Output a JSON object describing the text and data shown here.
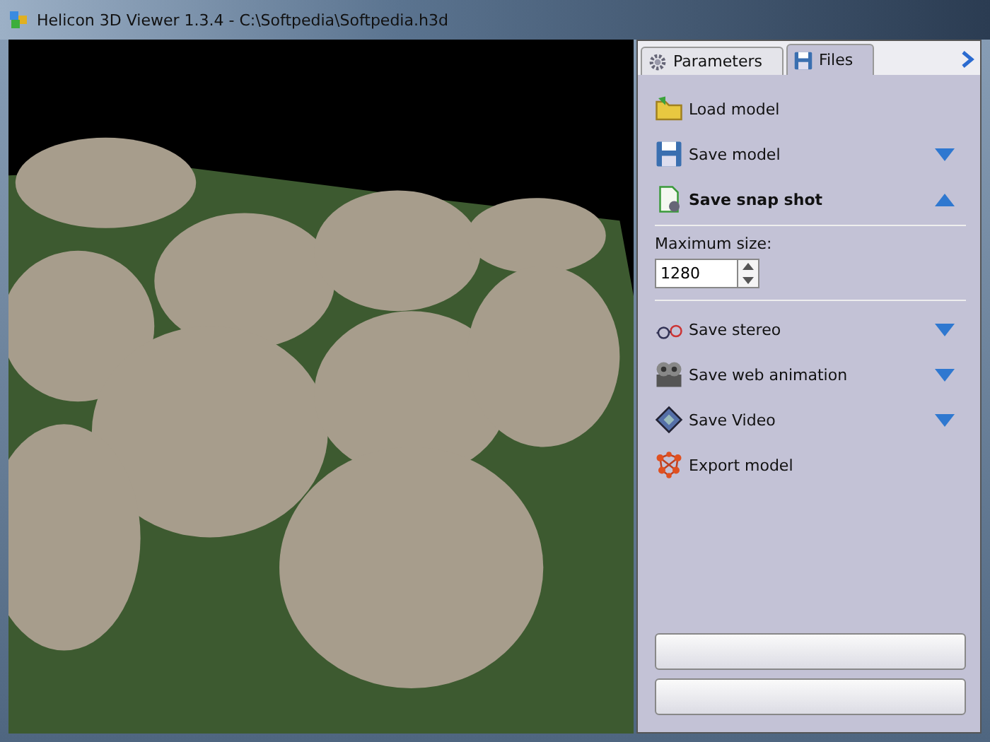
{
  "window": {
    "title": "Helicon 3D Viewer 1.3.4 - C:\\Softpedia\\Softpedia.h3d"
  },
  "tabs": [
    {
      "label": "Parameters",
      "selected": false
    },
    {
      "label": "Files",
      "selected": true
    }
  ],
  "files_panel": {
    "items": [
      {
        "label": "Load model"
      },
      {
        "label": "Save model",
        "expanded": false
      },
      {
        "label": "Save snap shot",
        "expanded": true,
        "options": {
          "label": "Maximum size:",
          "value": "1280"
        }
      },
      {
        "label": "Save stereo",
        "expanded": false
      },
      {
        "label": "Save web animation",
        "expanded": false
      },
      {
        "label": "Save Video",
        "expanded": false
      },
      {
        "label": "Export model"
      }
    ]
  }
}
